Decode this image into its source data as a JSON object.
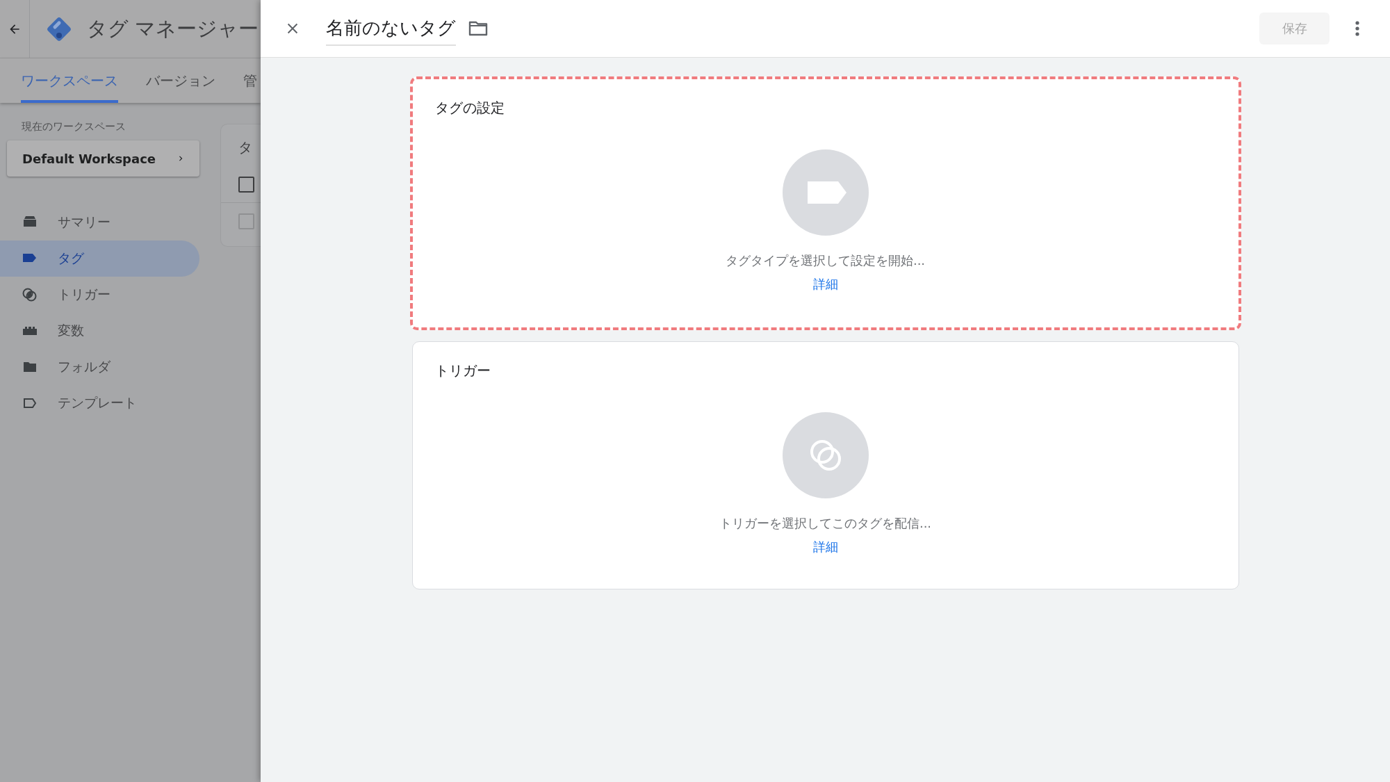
{
  "app_header": {
    "title": "タグ マネージャー"
  },
  "tabs": [
    {
      "label": "ワークスペース",
      "selected": true
    },
    {
      "label": "バージョン",
      "selected": false
    },
    {
      "label": "管",
      "selected": false
    }
  ],
  "workspace": {
    "label": "現在のワークスペース",
    "value": "Default Workspace"
  },
  "nav": [
    {
      "label": "サマリー",
      "kind": "summary",
      "selected": false
    },
    {
      "label": "タグ",
      "kind": "tag",
      "selected": true
    },
    {
      "label": "トリガー",
      "kind": "trigger",
      "selected": false
    },
    {
      "label": "変数",
      "kind": "variable",
      "selected": false
    },
    {
      "label": "フォルダ",
      "kind": "folder",
      "selected": false
    },
    {
      "label": "テンプレート",
      "kind": "template",
      "selected": false
    }
  ],
  "list_card": {
    "title": "タ",
    "checkboxes": [
      {
        "checked": false,
        "disabled": false
      },
      {
        "checked": false,
        "disabled": true
      }
    ]
  },
  "panel": {
    "title": "名前のないタグ",
    "save": {
      "label": "保存",
      "disabled": true
    }
  },
  "cards": [
    {
      "kind": "tag",
      "title": "タグの設定",
      "prompt": "タグタイプを選択して設定を開始...",
      "link": "詳細",
      "highlighted": true
    },
    {
      "kind": "trigger",
      "title": "トリガー",
      "prompt": "トリガーを選択してこのタグを配信...",
      "link": "詳細",
      "highlighted": false
    }
  ]
}
